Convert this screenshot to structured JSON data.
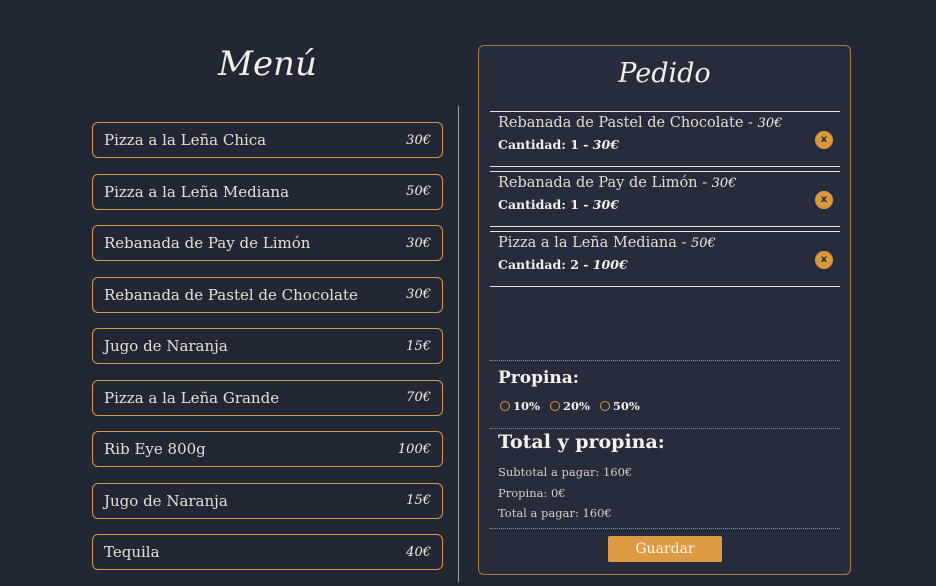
{
  "menu": {
    "title": "Menú",
    "items": [
      {
        "name": "Pizza a la Leña Chica",
        "price": "30€"
      },
      {
        "name": "Pizza a la Leña Mediana",
        "price": "50€"
      },
      {
        "name": "Rebanada de Pay de Limón",
        "price": "30€"
      },
      {
        "name": "Rebanada de Pastel de Chocolate",
        "price": "30€"
      },
      {
        "name": "Jugo de Naranja",
        "price": "15€"
      },
      {
        "name": "Pizza a la Leña Grande",
        "price": "70€"
      },
      {
        "name": "Rib Eye 800g",
        "price": "100€"
      },
      {
        "name": "Jugo de Naranja",
        "price": "15€"
      },
      {
        "name": "Tequila",
        "price": "40€"
      }
    ]
  },
  "order": {
    "title": "Pedido",
    "items": [
      {
        "name": "Rebanada de Pastel de Chocolate - ",
        "price": "30€",
        "qty_label": "Cantidad: 1 - ",
        "qty_total": "30€",
        "remove_label": "x"
      },
      {
        "name": "Rebanada de Pay de Limón - ",
        "price": "30€",
        "qty_label": "Cantidad: 1 - ",
        "qty_total": "30€",
        "remove_label": "x"
      },
      {
        "name": "Pizza a la Leña Mediana - ",
        "price": "50€",
        "qty_label": "Cantidad: 2 - ",
        "qty_total": "100€",
        "remove_label": "x"
      }
    ],
    "tip": {
      "heading": "Propina:",
      "options": [
        "10%",
        "20%",
        "50%"
      ]
    },
    "totals": {
      "heading": "Total y propina:",
      "subtotal": "Subtotal a pagar: 160€",
      "tip": "Propina: 0€",
      "total": "Total a pagar: 160€"
    },
    "save_label": "Guardar"
  },
  "colors": {
    "background": "#222736",
    "accent": "#d9973f",
    "panel": "#262c3c"
  }
}
